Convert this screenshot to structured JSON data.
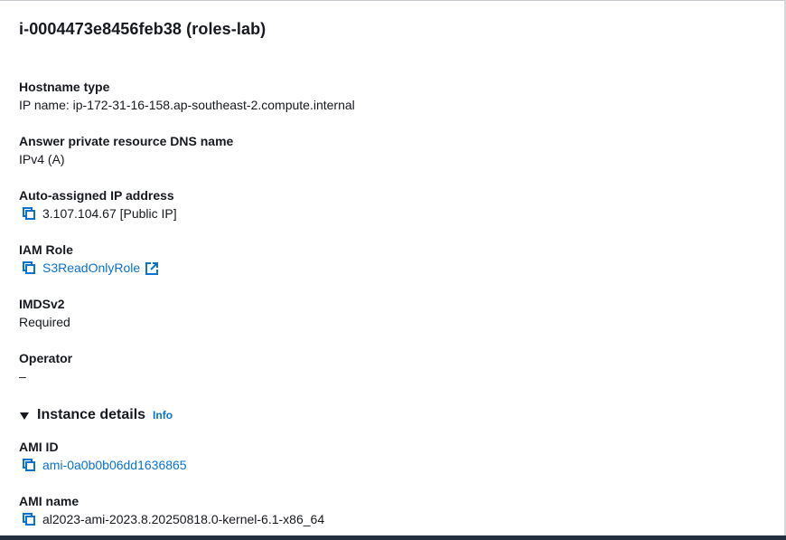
{
  "header": {
    "title": "i-0004473e8456feb38 (roles-lab)"
  },
  "fields": {
    "hostname_type": {
      "label": "Hostname type",
      "value": "IP name: ip-172-31-16-158.ap-southeast-2.compute.internal"
    },
    "answer_dns": {
      "label": "Answer private resource DNS name",
      "value": "IPv4 (A)"
    },
    "auto_ip": {
      "label": "Auto-assigned IP address",
      "value": "3.107.104.67 [Public IP]",
      "icon": "copy-icon"
    },
    "iam_role": {
      "label": "IAM Role",
      "value": "S3ReadOnlyRole",
      "icon": "copy-icon",
      "link_icon": "external-link-icon"
    },
    "imdsv2": {
      "label": "IMDSv2",
      "value": "Required"
    },
    "operator": {
      "label": "Operator",
      "value": "–"
    },
    "ami_id": {
      "label": "AMI ID",
      "value": "ami-0a0b0b06dd1636865",
      "icon": "copy-icon"
    },
    "ami_name": {
      "label": "AMI name",
      "value": "al2023-ami-2023.8.20250818.0-kernel-6.1-x86_64",
      "icon": "copy-icon"
    }
  },
  "section": {
    "title": "Instance details",
    "info_label": "Info",
    "expanded": true
  },
  "colors": {
    "link": "#0972d3",
    "text": "#16191f",
    "bottom_bar": "#232f3e"
  }
}
